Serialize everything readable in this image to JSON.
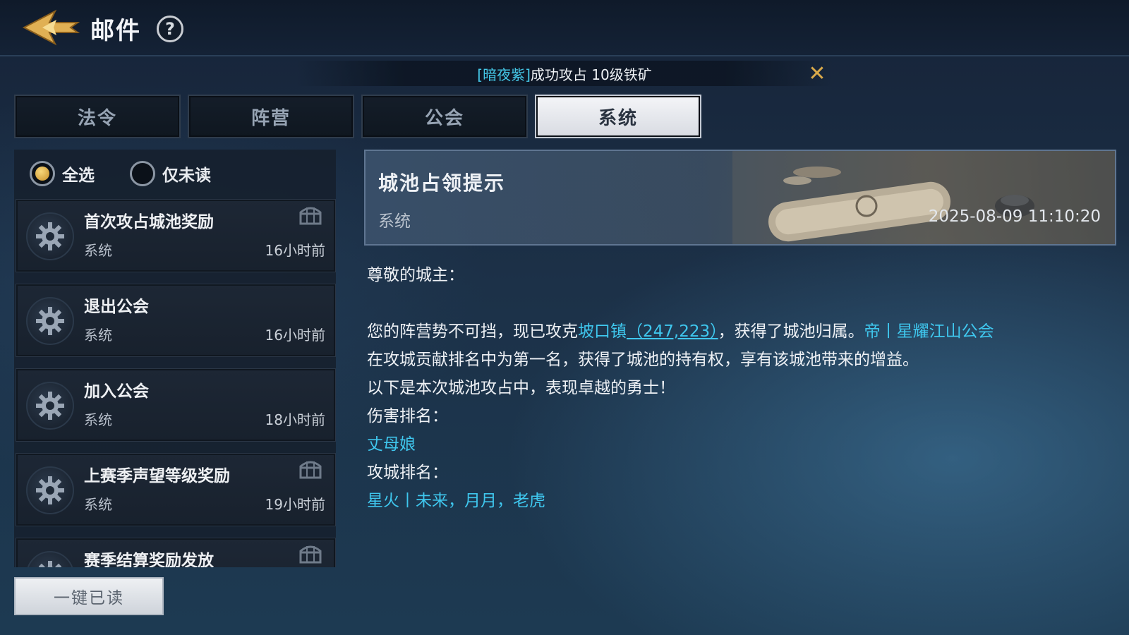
{
  "header": {
    "title": "邮件",
    "help": "?"
  },
  "banner": {
    "tag": "[暗夜紫]",
    "message": "成功攻占 10级铁矿",
    "close": "✕"
  },
  "tabs": [
    "法令",
    "阵营",
    "公会",
    "系统"
  ],
  "active_tab": "系统",
  "filters": {
    "select_all": "全选",
    "unread_only": "仅未读"
  },
  "mail_list": [
    {
      "title": "首次攻占城池奖励",
      "sender": "系统",
      "time": "16小时前",
      "has_attachment": true
    },
    {
      "title": "退出公会",
      "sender": "系统",
      "time": "16小时前",
      "has_attachment": false
    },
    {
      "title": "加入公会",
      "sender": "系统",
      "time": "18小时前",
      "has_attachment": false
    },
    {
      "title": "上赛季声望等级奖励",
      "sender": "系统",
      "time": "19小时前",
      "has_attachment": true
    },
    {
      "title": "赛季结算奖励发放",
      "sender": "",
      "time": "",
      "has_attachment": true
    }
  ],
  "read_all_button": "一键已读",
  "detail": {
    "title": "城池占领提示",
    "sender": "系统",
    "time": "2025-08-09 11:10:20",
    "greeting": "尊敬的城主：",
    "p1_a": "您的阵营势不可挡，现已攻克",
    "p1_city": "坡口镇",
    "p1_coords": "（247,223）",
    "p1_b": "，获得了城池归属。",
    "p1_guild": "帝丨星耀江山公会",
    "p2": "在攻城贡献排名中为第一名，获得了城池的持有权，享有该城池带来的增益。",
    "p3": "以下是本次城池攻占中，表现卓越的勇士！",
    "damage_label": "伤害排名：",
    "damage_names": "丈母娘",
    "siege_label": "攻城排名：",
    "siege_names": "星火丨未来，月月，老虎"
  },
  "colors": {
    "highlight": "#3fc7ee",
    "gold": "#d9a94a"
  },
  "icons": {
    "back": "back-arrow-icon",
    "gear": "gear-icon",
    "attachment": "treasure-chest-icon",
    "close": "close-icon"
  }
}
